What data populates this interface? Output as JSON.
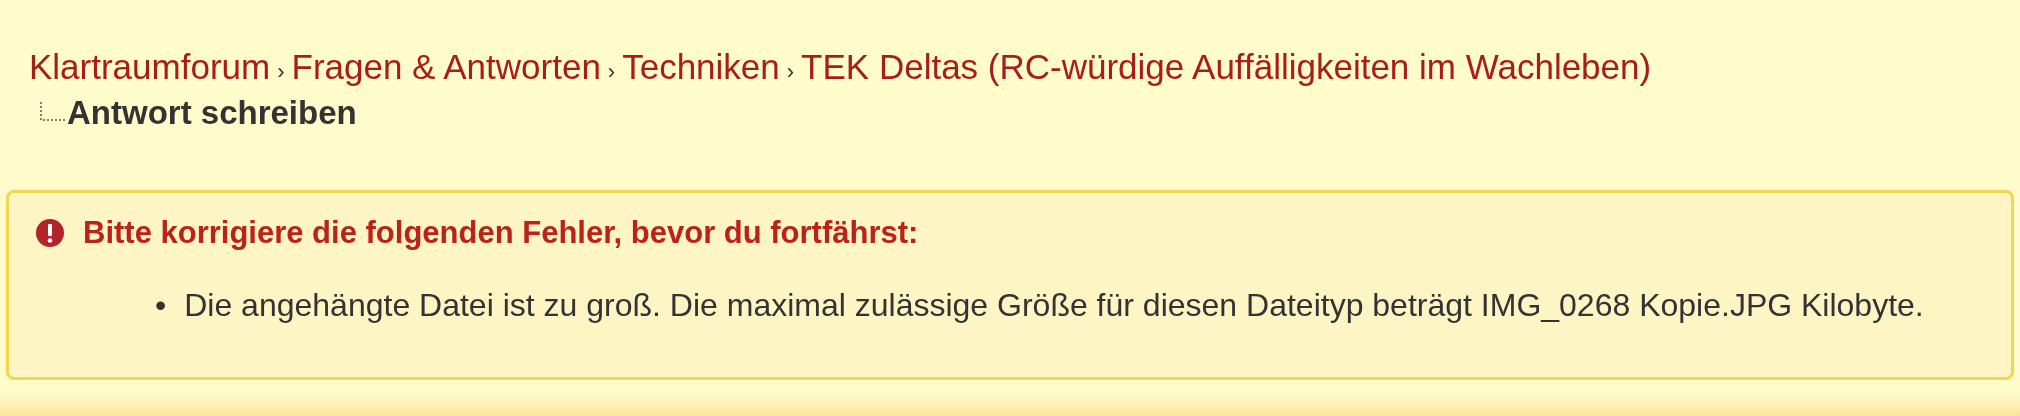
{
  "breadcrumb": {
    "items": [
      {
        "label": "Klartraumforum",
        "separator": "›"
      },
      {
        "label": "Fragen & Antworten",
        "separator": "›"
      },
      {
        "label": "Techniken",
        "separator": "›"
      },
      {
        "label": "TEK Deltas (RC-würdige Auffälligkeiten im Wachleben)"
      }
    ],
    "current": "Antwort schreiben"
  },
  "error_box": {
    "title": "Bitte korrigiere die folgenden Fehler, bevor du fortfährst:",
    "errors": [
      {
        "bullet": "•",
        "text": "Die angehängte Datei ist zu groß. Die maximal zulässige Größe für diesen Dateityp beträgt IMG_0268 Kopie.JPG Kilobyte."
      }
    ]
  }
}
